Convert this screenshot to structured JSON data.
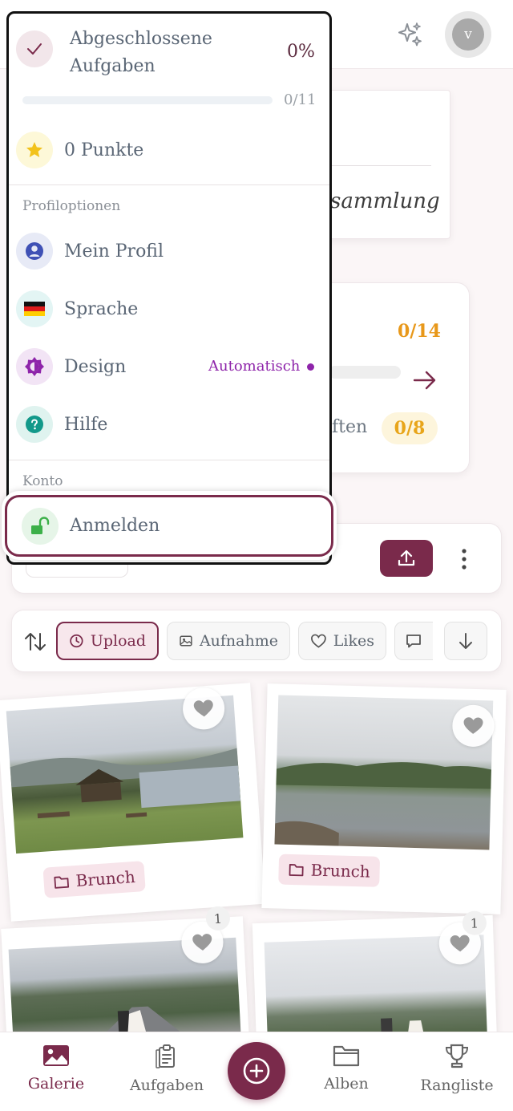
{
  "header": {
    "avatar_initial": "v",
    "sparkle_icon": "sparkles-icon"
  },
  "collection_card": {
    "text": "sammlung"
  },
  "tasks_card": {
    "count": "0/14",
    "word": "ften",
    "pill": "0/8"
  },
  "filters": {
    "chips": [
      "Upload",
      "Aufnahme",
      "Likes"
    ],
    "active": "Upload"
  },
  "gallery": {
    "items": [
      {
        "album": "Brunch",
        "likes": ""
      },
      {
        "album": "Brunch",
        "likes": ""
      },
      {
        "album": "",
        "likes": "1"
      },
      {
        "album": "",
        "likes": "1"
      }
    ]
  },
  "bottom_nav": {
    "items": [
      "Galerie",
      "Aufgaben",
      "Alben",
      "Rangliste"
    ],
    "active": "Galerie"
  },
  "menu": {
    "progress": {
      "title_line1": "Abgeschlossene",
      "title_line2": "Aufgaben",
      "percent": "0%",
      "fraction": "0/11",
      "value": 0
    },
    "points": "0 Punkte",
    "profile_section": "Profiloptionen",
    "profile_items": [
      {
        "label": "Mein Profil",
        "icon": "user-icon"
      },
      {
        "label": "Sprache",
        "icon": "german-flag-icon"
      },
      {
        "label": "Design",
        "icon": "theme-icon",
        "value": "Automatisch"
      },
      {
        "label": "Hilfe",
        "icon": "help-icon"
      }
    ],
    "account_section": "Konto",
    "login": "Anmelden"
  },
  "colors": {
    "primary": "#7a2a4b",
    "gold": "#e8981a",
    "purple": "#8e24aa"
  }
}
